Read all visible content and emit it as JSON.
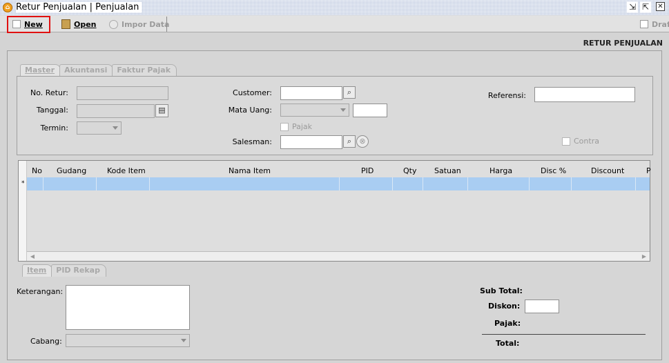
{
  "window": {
    "title": "Retur Penjualan | Penjualan",
    "controls": [
      "restore-icon",
      "popout-icon",
      "close-icon"
    ]
  },
  "toolbar": {
    "new_label": "New",
    "open_label": "Open",
    "impor_label": "Impor Data",
    "draft_label": "Draft"
  },
  "header": {
    "title": "RETUR PENJUALAN"
  },
  "top_tabs": [
    "Master",
    "Akuntansi",
    "Faktur Pajak"
  ],
  "form": {
    "no_retur_label": "No. Retur:",
    "tanggal_label": "Tanggal:",
    "termin_label": "Termin:",
    "customer_label": "Customer:",
    "mata_uang_label": "Mata Uang:",
    "pajak_label": "Pajak",
    "salesman_label": "Salesman:",
    "referensi_label": "Referensi:",
    "contra_label": "Contra"
  },
  "grid": {
    "columns": [
      "No",
      "Gudang",
      "Kode Item",
      "Nama Item",
      "PID",
      "Qty",
      "Satuan",
      "Harga",
      "Disc %",
      "Discount",
      "P"
    ],
    "new_row_marker": "*"
  },
  "bottom_tabs": [
    "Item",
    "PID Rekap"
  ],
  "footer": {
    "keterangan_label": "Keterangan:",
    "cabang_label": "Cabang:",
    "sub_total_label": "Sub Total:",
    "diskon_label": "Diskon:",
    "pajak_label": "Pajak:",
    "total_label": "Total:"
  },
  "colors": {
    "highlight": "#e01010",
    "row_selected": "#a9cdf2",
    "app_icon": "#f0a020"
  }
}
